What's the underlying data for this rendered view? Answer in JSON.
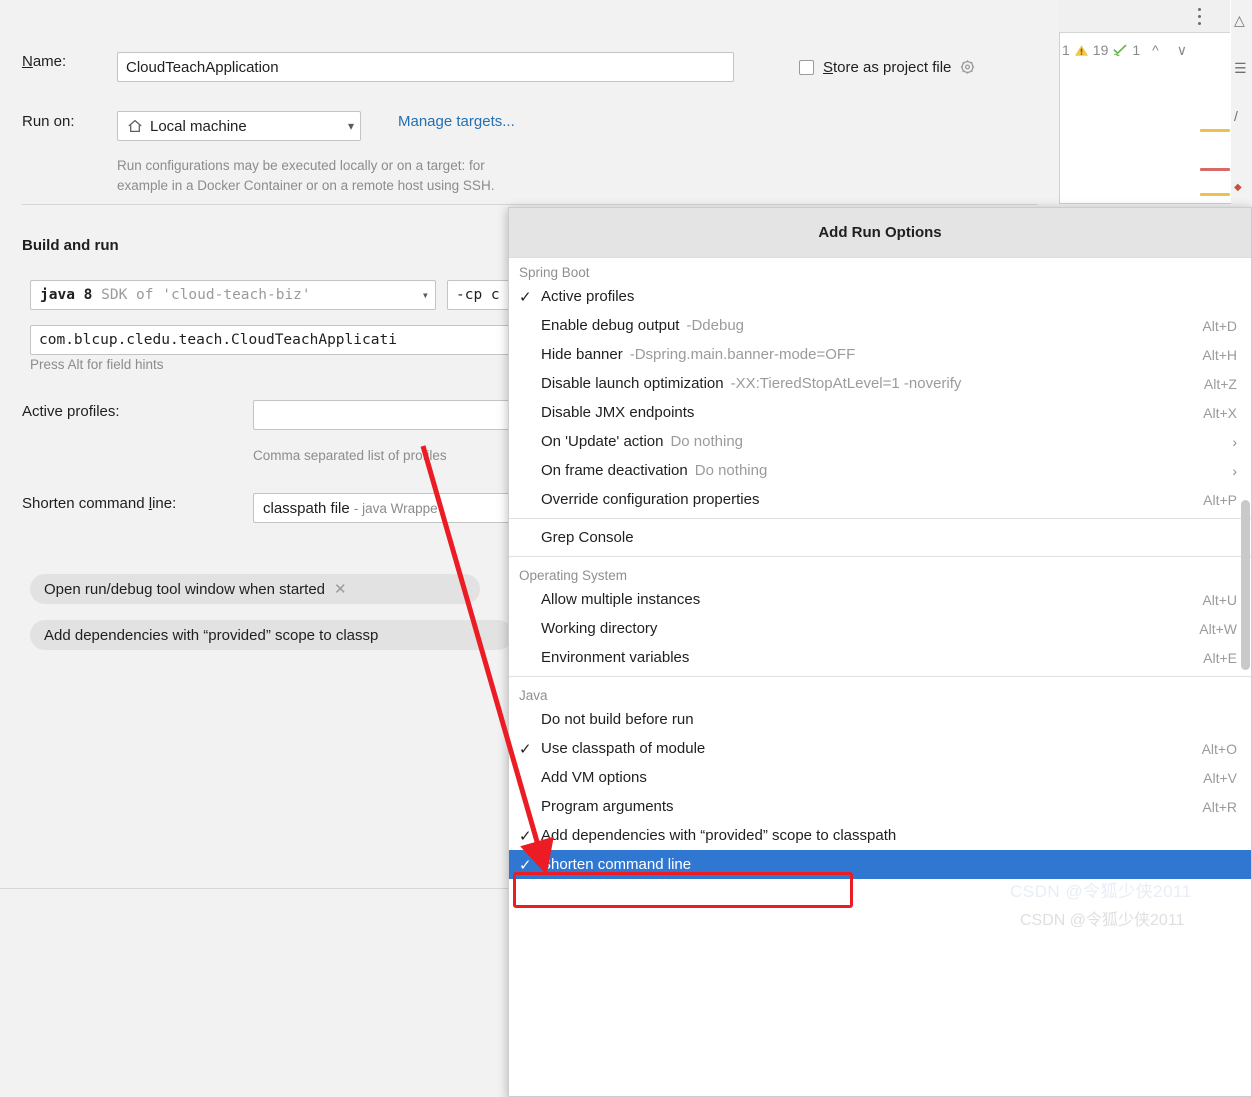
{
  "dialog": {
    "name_label": "Name:",
    "name_value": "CloudTeachApplication",
    "store_as_project_file_label": "Store as project file",
    "store_gear_icon": "gear-icon",
    "run_on_label": "Run on:",
    "run_on_value": "Local machine",
    "run_on_icon": "home-icon",
    "manage_targets_link": "Manage targets...",
    "run_on_hint_line1": "Run configurations may be executed locally or on a target: for",
    "run_on_hint_line2": "example in a Docker Container or on a remote host using SSH.",
    "build_and_run_title": "Build and run",
    "sdk_value_bold": "java 8",
    "sdk_value_dim": "SDK of 'cloud-teach-biz'",
    "vm_options_value": "-cp c",
    "main_class_value": "com.blcup.cledu.teach.CloudTeachApplicati",
    "field_hints": "Press Alt for field hints",
    "active_profiles_label": "Active profiles:",
    "active_profiles_value": "",
    "active_profiles_hint": "Comma separated list of profiles",
    "shorten_cmd_label": "Shorten command line:",
    "shorten_cmd_value_bold": "classpath file",
    "shorten_cmd_value_dim": "- java Wrappe",
    "chip_open_tool_window": "Open run/debug tool window when started",
    "chip_close_icon": "close-icon",
    "chip_add_dependencies": "Add dependencies with “provided” scope to classp"
  },
  "editor": {
    "kebab_icon": "more-options-icon",
    "inspection_count_prefix": "1",
    "warning_icon": "warning-triangle-icon",
    "warning_count": "19",
    "check_icon": "green-check-icon",
    "check_count": "1",
    "prev_icon": "chevron-up-icon",
    "next_icon": "chevron-down-icon"
  },
  "popup": {
    "title": "Add Run Options",
    "groups": [
      {
        "label": "Spring Boot",
        "items": [
          {
            "checked": true,
            "label": "Active profiles",
            "sub": "",
            "key": ""
          },
          {
            "checked": false,
            "label": "Enable debug output",
            "sub": "-Ddebug",
            "key": "Alt+D"
          },
          {
            "checked": false,
            "label": "Hide banner",
            "sub": "-Dspring.main.banner-mode=OFF",
            "key": "Alt+H"
          },
          {
            "checked": false,
            "label": "Disable launch optimization",
            "sub": "-XX:TieredStopAtLevel=1 -noverify",
            "key": "Alt+Z"
          },
          {
            "checked": false,
            "label": "Disable JMX endpoints",
            "sub": "",
            "key": "Alt+X"
          },
          {
            "checked": false,
            "label": "On 'Update' action",
            "sub": "Do nothing",
            "key": "",
            "arrow": "›"
          },
          {
            "checked": false,
            "label": "On frame deactivation",
            "sub": "Do nothing",
            "key": "",
            "arrow": "›"
          },
          {
            "checked": false,
            "label": "Override configuration properties",
            "sub": "",
            "key": "Alt+P"
          }
        ]
      },
      {
        "label": "",
        "items": [
          {
            "checked": false,
            "label": "Grep Console",
            "sub": "",
            "key": ""
          }
        ]
      },
      {
        "label": "Operating System",
        "items": [
          {
            "checked": false,
            "label": "Allow multiple instances",
            "sub": "",
            "key": "Alt+U"
          },
          {
            "checked": false,
            "label": "Working directory",
            "sub": "",
            "key": "Alt+W"
          },
          {
            "checked": false,
            "label": "Environment variables",
            "sub": "",
            "key": "Alt+E"
          }
        ]
      },
      {
        "label": "Java",
        "items": [
          {
            "checked": false,
            "label": "Do not build before run",
            "sub": "",
            "key": ""
          },
          {
            "checked": true,
            "label": "Use classpath of module",
            "sub": "",
            "key": "Alt+O"
          },
          {
            "checked": false,
            "label": "Add VM options",
            "sub": "",
            "key": "Alt+V"
          },
          {
            "checked": false,
            "label": "Program arguments",
            "sub": "",
            "key": "Alt+R"
          },
          {
            "checked": true,
            "label": "Add dependencies with “provided” scope to classpath",
            "sub": "",
            "key": ""
          },
          {
            "checked": true,
            "label": "Shorten command line",
            "sub": "",
            "key": "",
            "selected": true
          }
        ]
      }
    ]
  },
  "annotation": {
    "highlight_color": "#ec1c24",
    "selection_color": "#2f77d0",
    "watermark": "CSDN @令狐少侠2011",
    "watermark_faint": "CSDN @令狐少侠2011"
  }
}
